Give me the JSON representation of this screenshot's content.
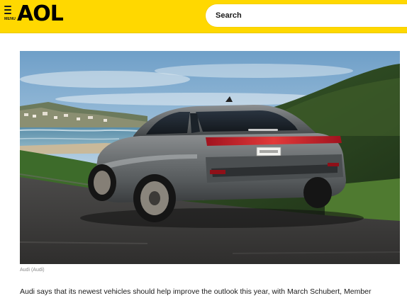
{
  "header": {
    "menu_label": "MENU",
    "logo_text": "AOL",
    "brand_color": "#ffd800",
    "search": {
      "placeholder": "Search",
      "value": ""
    }
  },
  "article": {
    "image_caption": "Audi (Audi)",
    "body_text": "Audi says that its newest vehicles should help improve the outlook this year, with March Schubert, Member"
  },
  "icons": {
    "menu": "hamburger-menu-icon"
  }
}
